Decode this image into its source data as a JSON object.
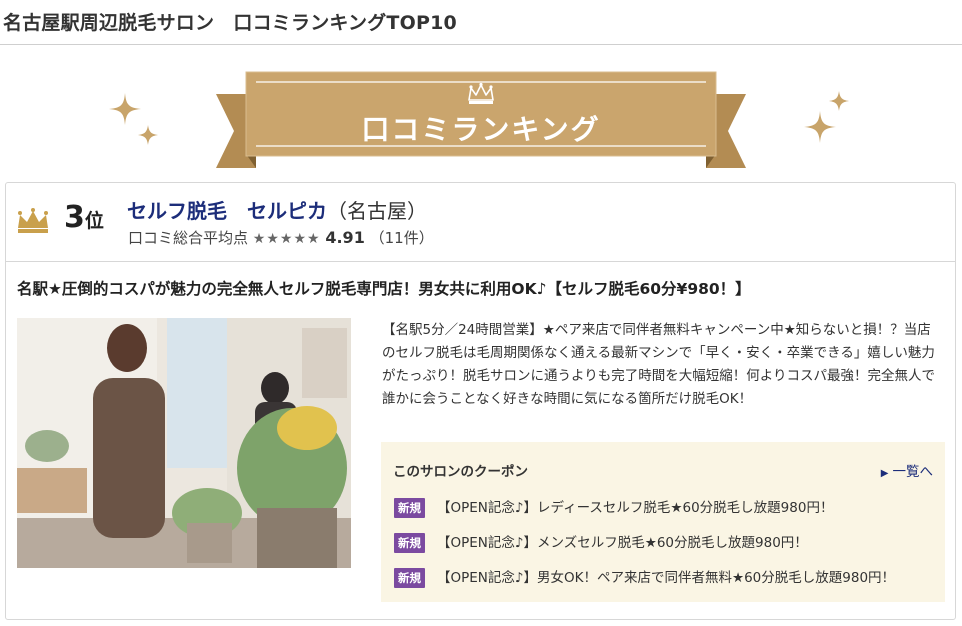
{
  "page": {
    "title": "名古屋駅周辺脱毛サロン　口コミランキングTOP10"
  },
  "banner": {
    "label": "口コミランキング",
    "colors": {
      "ribbon": "#c9a46b",
      "ribbon_dark": "#a98349",
      "sparkle": "#c8a46a"
    },
    "icons": [
      "crown-icon",
      "sparkle-icon"
    ]
  },
  "card": {
    "rank_number": "3",
    "rank_suffix": "位",
    "salon_name": "セルフ脱毛　セルピカ",
    "salon_area": "（名古屋）",
    "rating_label": "口コミ総合平均点",
    "stars": "★★★★★",
    "rating_value": 4.5,
    "score": "4.91",
    "review_count": "（11件）",
    "headline": "名駅★圧倒的コスパが魅力の完全無人セルフ脱毛専門店！男女共に利用OK♪【セルフ脱毛60分¥980！】",
    "description": "【名駅5分／24時間営業】★ペア来店で同伴者無料キャンペーン中★知らないと損！？当店のセルフ脱毛は毛周期関係なく通える最新マシンで「早く・安く・卒業できる」嬉しい魅力がたっぷり！脱毛サロンに通うよりも完了時間を大幅短縮！何よりコスパ最強！完全無人で誰かに会うことなく好きな時間に気になる箇所だけ脱毛OK！"
  },
  "coupons": {
    "title": "このサロンのクーポン",
    "view_all": "一覧へ",
    "badge_label": "新規",
    "items": [
      {
        "text": "【OPEN記念♪】レディースセルフ脱毛★60分脱毛し放題980円！"
      },
      {
        "text": "【OPEN記念♪】メンズセルフ脱毛★60分脱毛し放題980円！"
      },
      {
        "text": "【OPEN記念♪】男女OK！ペア来店で同伴者無料★60分脱毛し放題980円！"
      }
    ]
  },
  "colors": {
    "salon_link": "#1c2d7a",
    "badge": "#7b4aa0",
    "coupon_bg": "#faf5e4",
    "gold": "#c9a46b"
  }
}
